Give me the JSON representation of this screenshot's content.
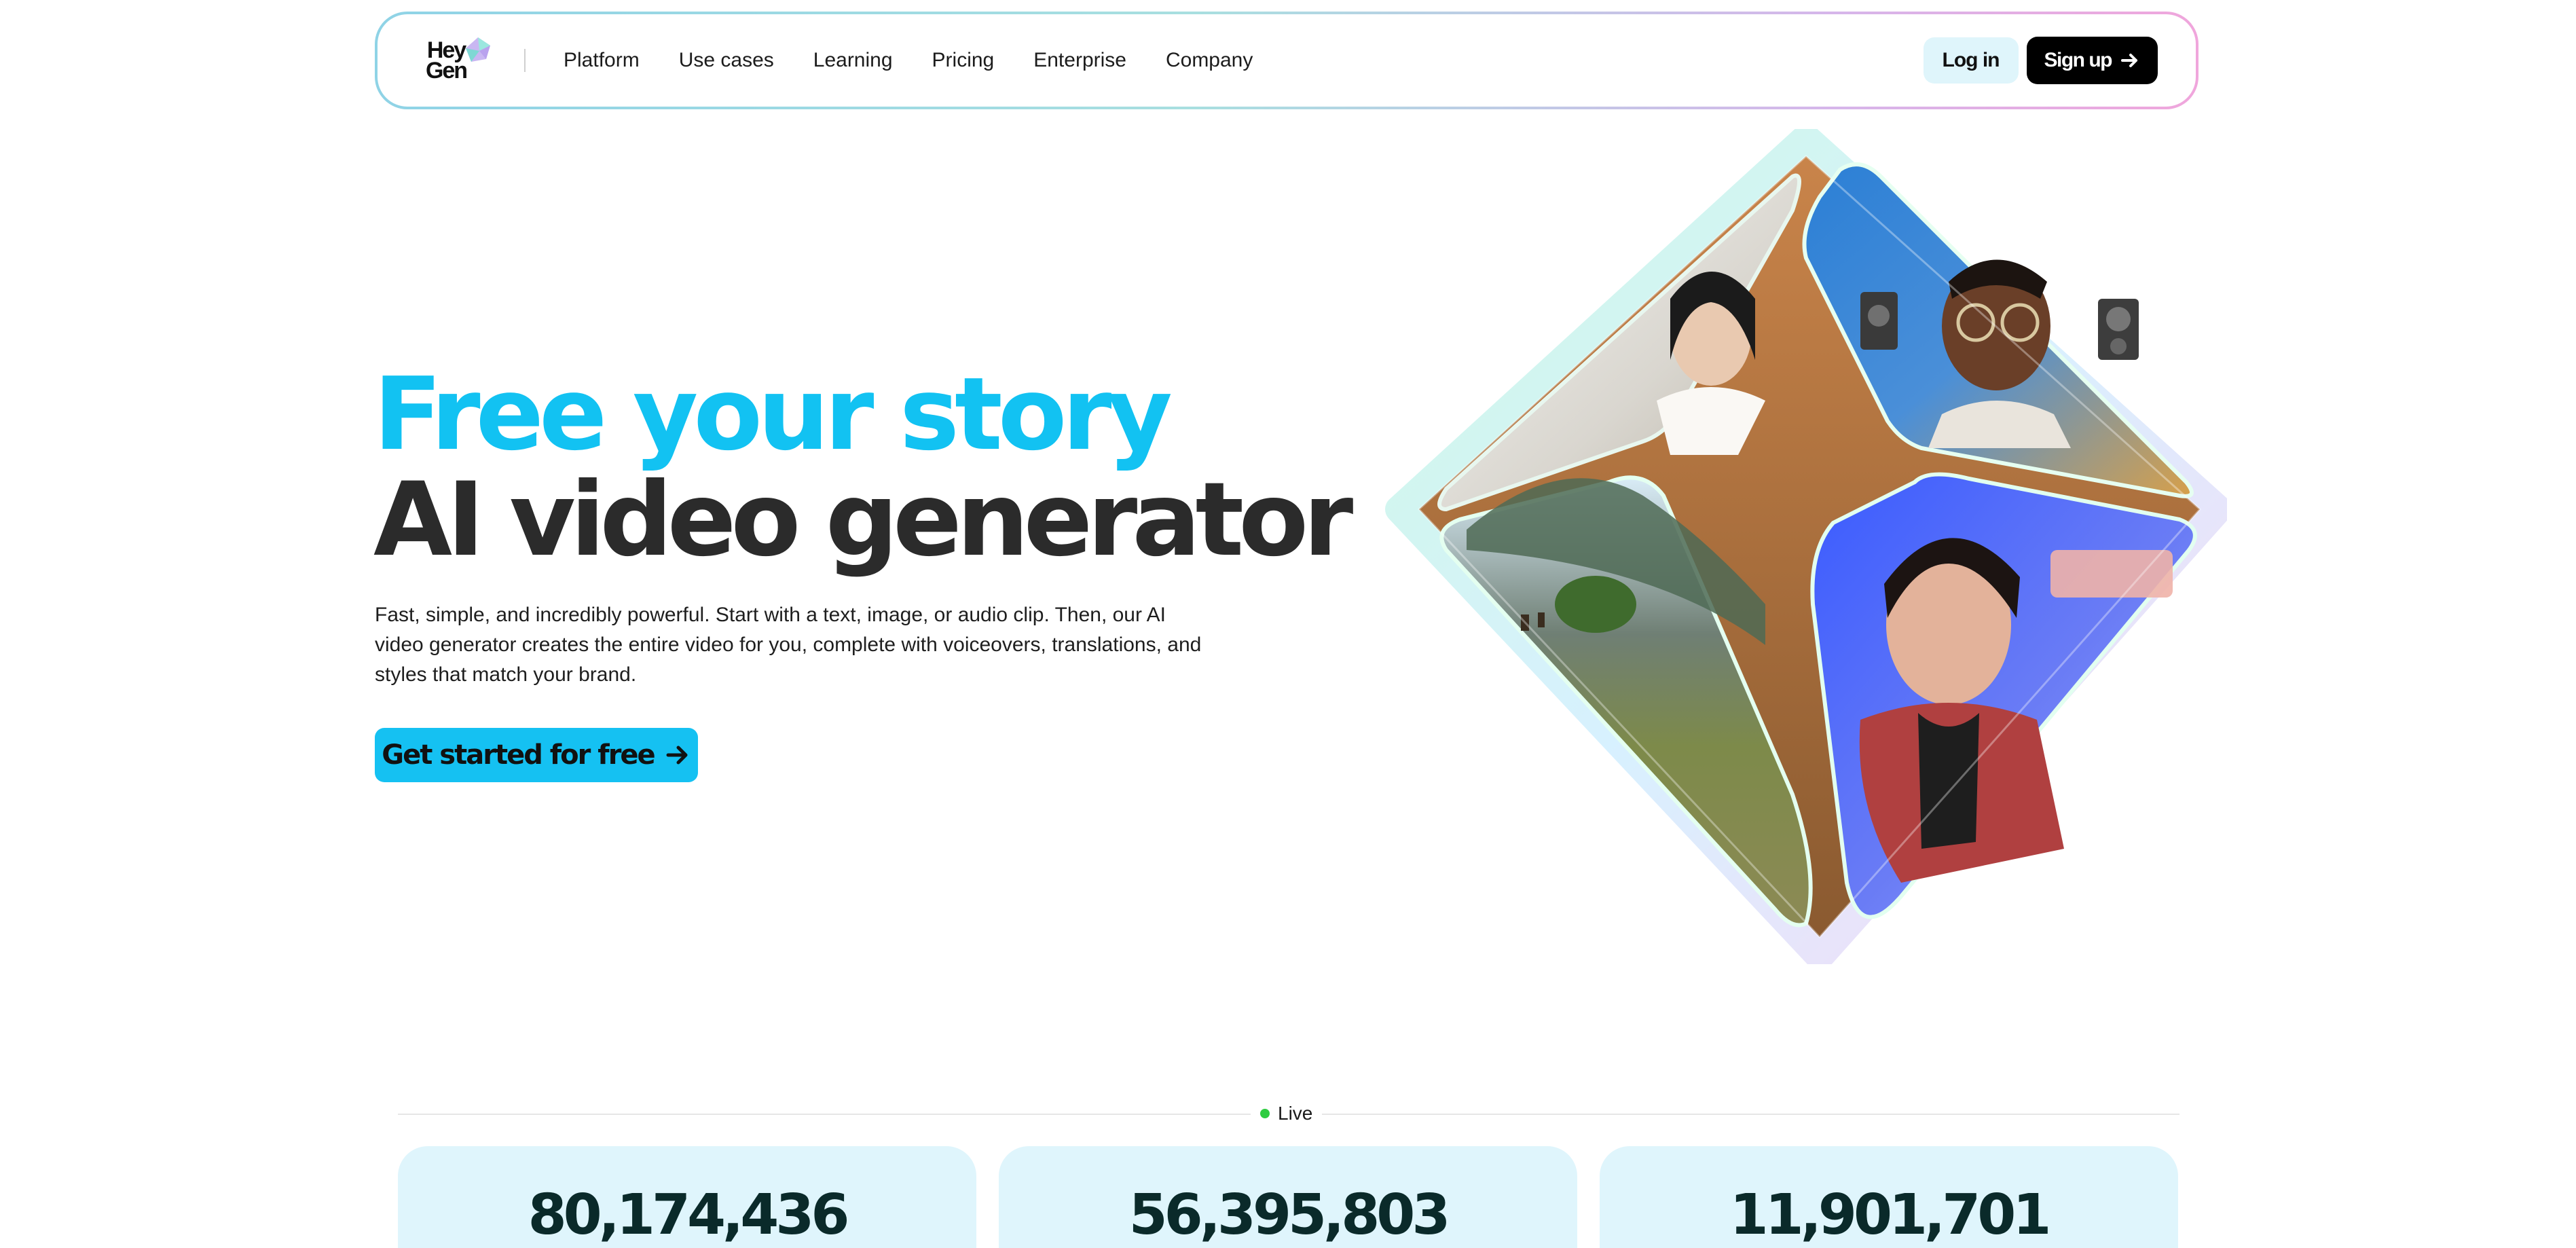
{
  "nav": {
    "logo_text": "Hey\nGen",
    "links": [
      "Platform",
      "Use cases",
      "Learning",
      "Pricing",
      "Enterprise",
      "Company"
    ],
    "login_label": "Log in",
    "signup_label": "Sign up"
  },
  "hero": {
    "title_line1": "Free your story",
    "title_line2": "AI video generator",
    "description": "Fast, simple, and incredibly powerful. Start with a text, image, or audio clip. Then, our AI video generator creates the entire video for you, complete with voiceovers, translations, and styles that match your brand.",
    "cta_label": "Get started for free"
  },
  "stats": {
    "live_label": "Live",
    "values": [
      "80,174,436",
      "56,395,803",
      "11,901,701"
    ]
  },
  "colors": {
    "accent": "#12c2f2",
    "dark": "#2b2b2b",
    "card_bg": "#dff5fc",
    "live_dot": "#2ecc40"
  },
  "icons": {
    "logo_gem": "heygen-gem-icon",
    "arrow": "arrow-right-icon"
  }
}
